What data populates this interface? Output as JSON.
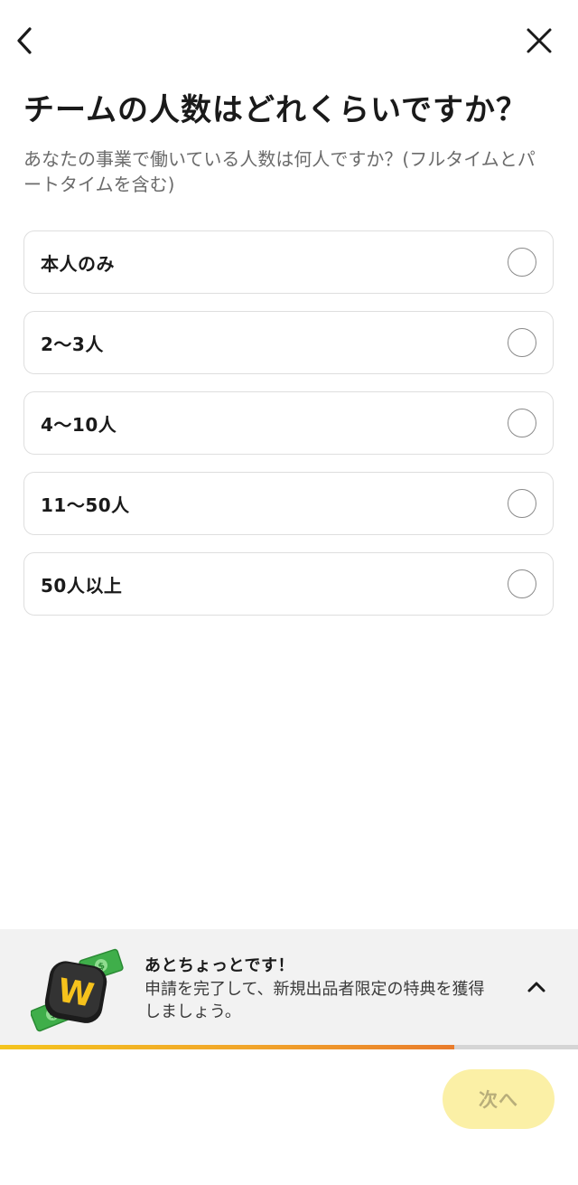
{
  "header": {
    "back_icon": "chevron-left-icon",
    "close_icon": "close-icon"
  },
  "question": {
    "title": "チームの人数はどれくらいですか？",
    "subtitle": "あなたの事業で働いている人数は何人ですか？(フルタイムとパートタイムを含む)"
  },
  "options": [
    {
      "label": "本人のみ",
      "selected": false
    },
    {
      "label": "2〜3人",
      "selected": false
    },
    {
      "label": "4〜10人",
      "selected": false
    },
    {
      "label": "11〜50人",
      "selected": false
    },
    {
      "label": "50人以上",
      "selected": false
    }
  ],
  "banner": {
    "title": "あとちょっとです！",
    "body": "申請を完了して、新規出品者限定の特典を獲得しましょう。",
    "illustration": "money-w-badge-illustration",
    "expand_icon": "chevron-up-icon"
  },
  "progress": {
    "fraction": 0.786,
    "colors": {
      "start": "#f4c41e",
      "end": "#e97c2c",
      "track": "#d5d5d5"
    }
  },
  "footer": {
    "next_label": "次へ",
    "next_enabled": false,
    "next_color": "#fbf0a6"
  }
}
